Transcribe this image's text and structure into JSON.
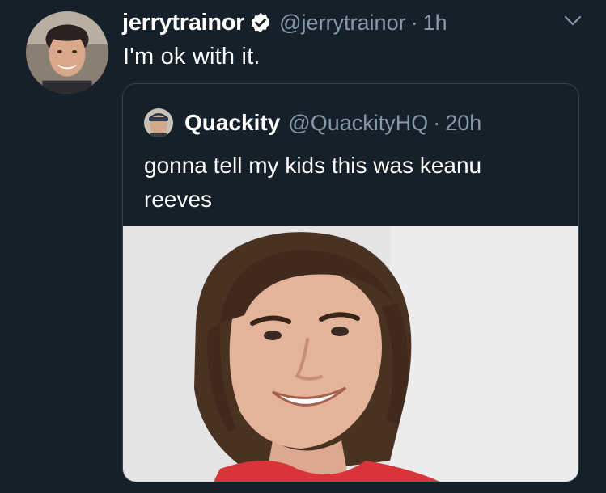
{
  "tweet": {
    "display_name": "jerrytrainor",
    "verified_icon": "verified-badge-icon",
    "handle": "@jerrytrainor",
    "separator": "·",
    "time": "1h",
    "text": "I'm ok with it.",
    "menu_icon": "chevron-down-icon"
  },
  "quote": {
    "display_name": "Quackity",
    "handle": "@QuackityHQ",
    "separator": "·",
    "time": "20h",
    "text": "gonna tell my kids this was keanu reeves",
    "media_icon": "photo"
  },
  "colors": {
    "background": "#15202b",
    "border": "#38444d",
    "muted_text": "#8899a6",
    "verified": "#ffffff"
  }
}
